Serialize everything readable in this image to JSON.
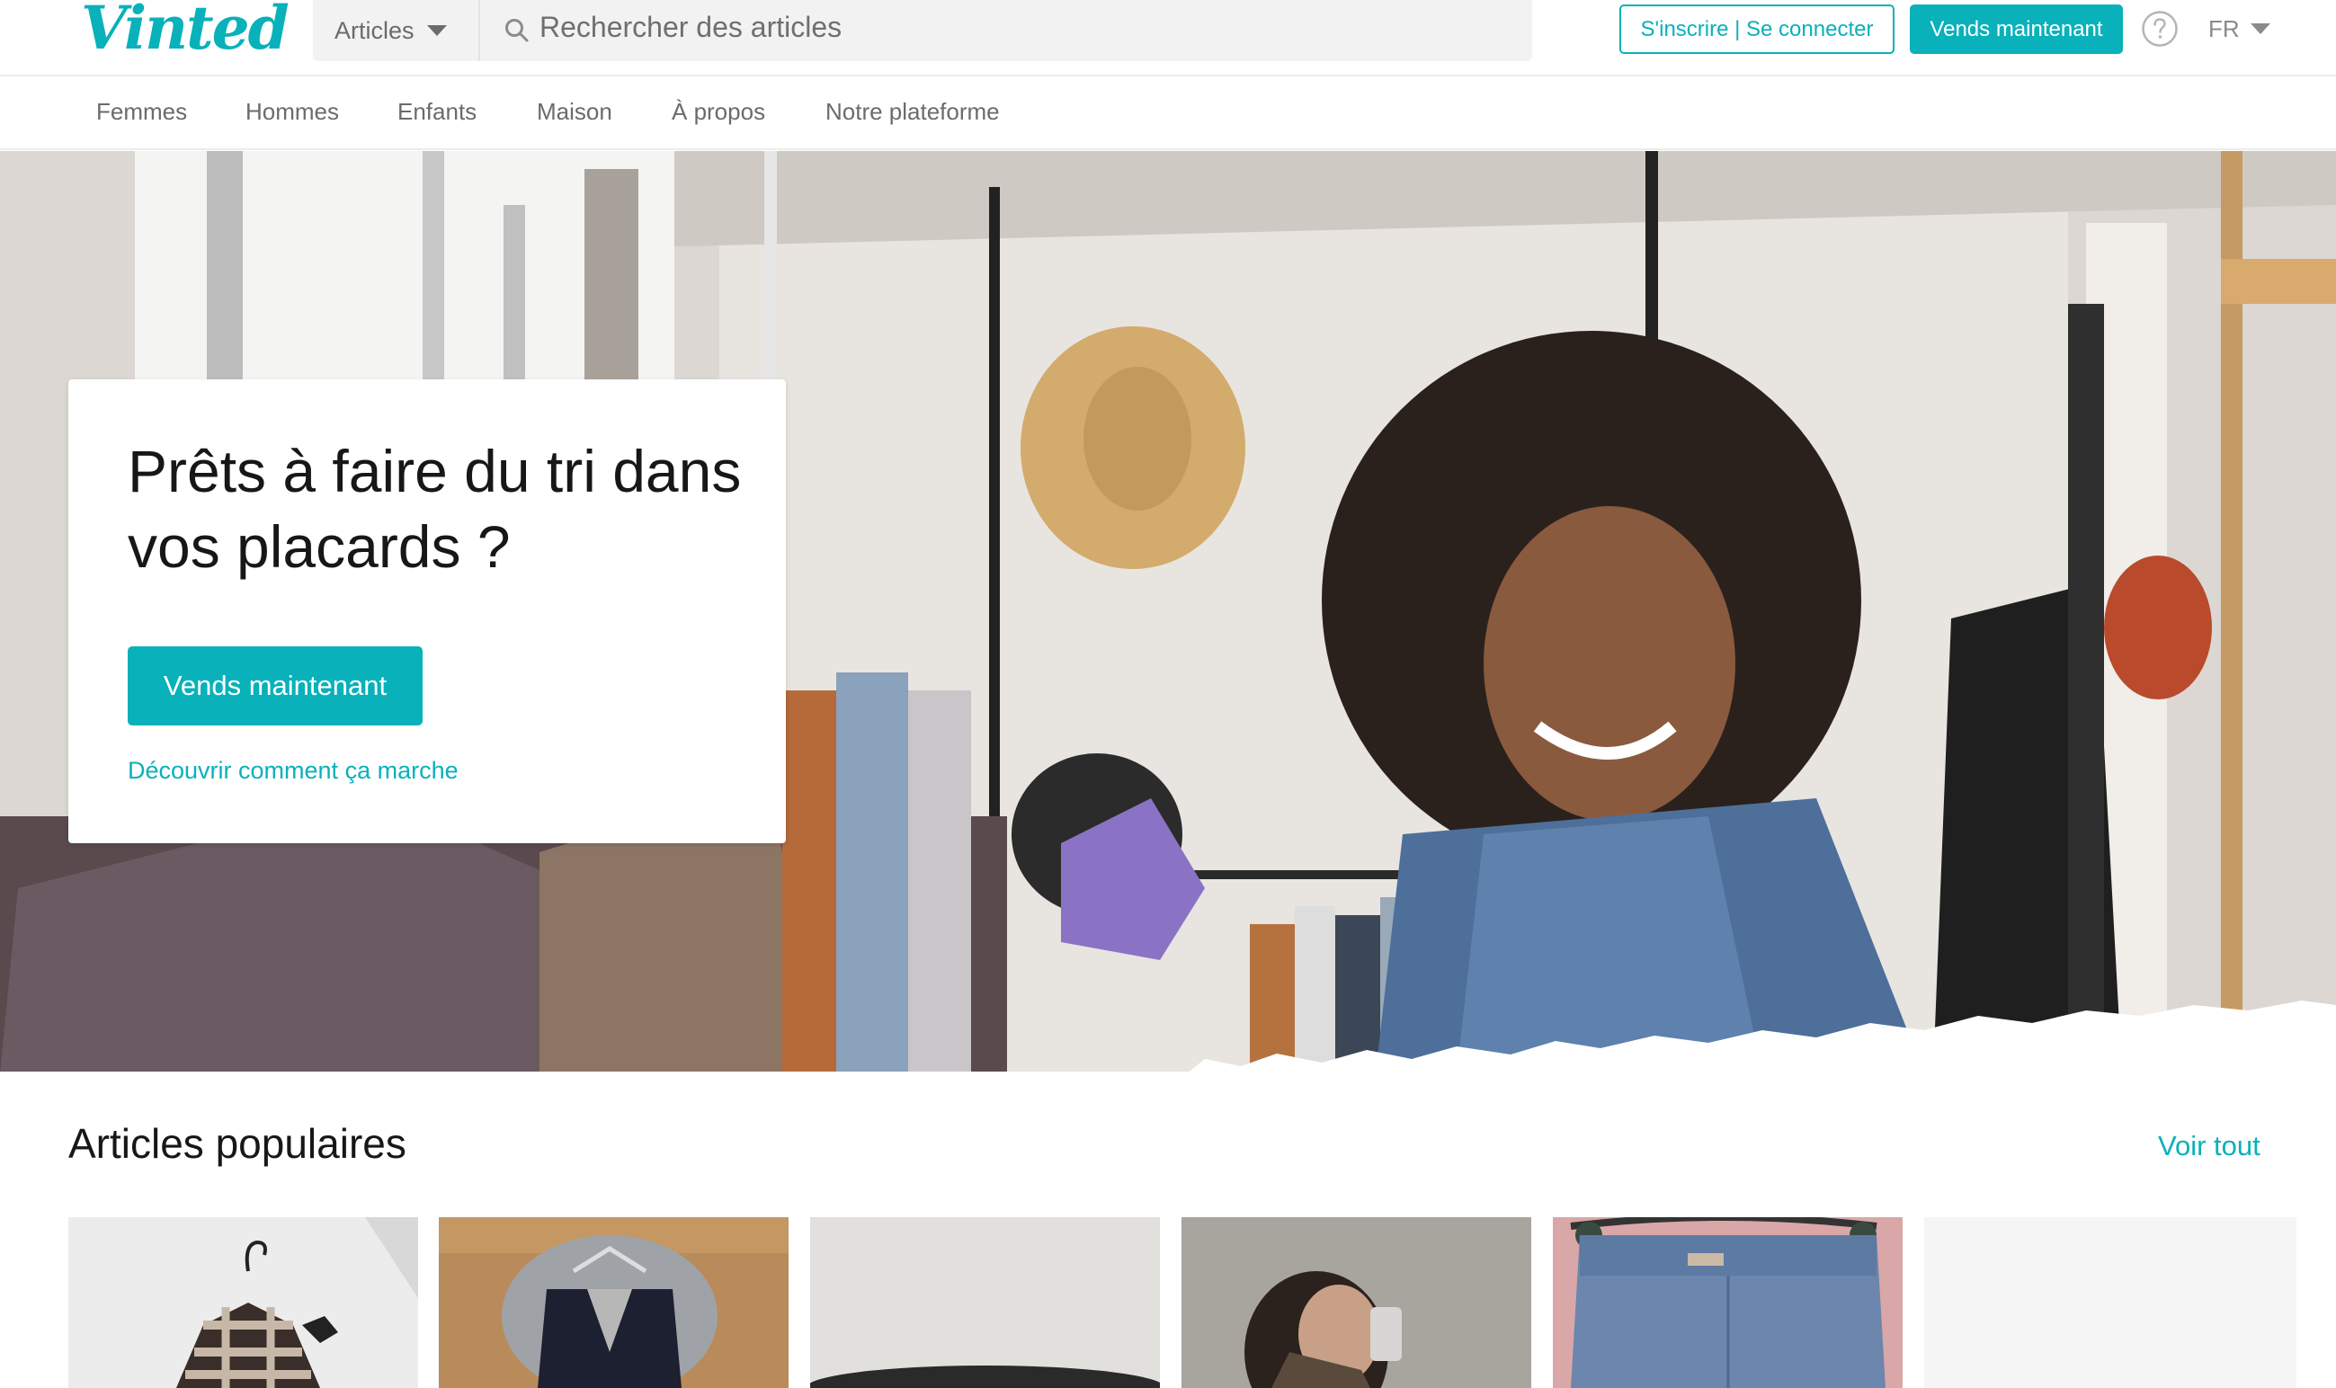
{
  "header": {
    "logo": "Vinted",
    "catalog_select": "Articles",
    "search_placeholder": "Rechercher des articles",
    "signup_login": "S'inscrire | Se connecter",
    "sell_now": "Vends maintenant",
    "help_icon": "question-circle-icon",
    "language": "FR",
    "accent_color": "#09b1ba"
  },
  "nav": {
    "items": [
      {
        "label": "Femmes"
      },
      {
        "label": "Hommes"
      },
      {
        "label": "Enfants"
      },
      {
        "label": "Maison"
      },
      {
        "label": "À propos"
      },
      {
        "label": "Notre plateforme"
      }
    ]
  },
  "hero": {
    "title": "Prêts à faire du tri dans vos placards ?",
    "cta": "Vends maintenant",
    "link": "Découvrir comment ça marche"
  },
  "popular": {
    "title": "Articles populaires",
    "see_all": "Voir tout",
    "items": [
      {
        "image": "checked-shirt-on-hanger"
      },
      {
        "image": "black-vest-on-hanger"
      },
      {
        "image": "black-item-on-white"
      },
      {
        "image": "woman-mirror-selfie"
      },
      {
        "image": "blue-jeans-on-hanger"
      },
      {
        "image": "empty-placeholder"
      }
    ]
  }
}
